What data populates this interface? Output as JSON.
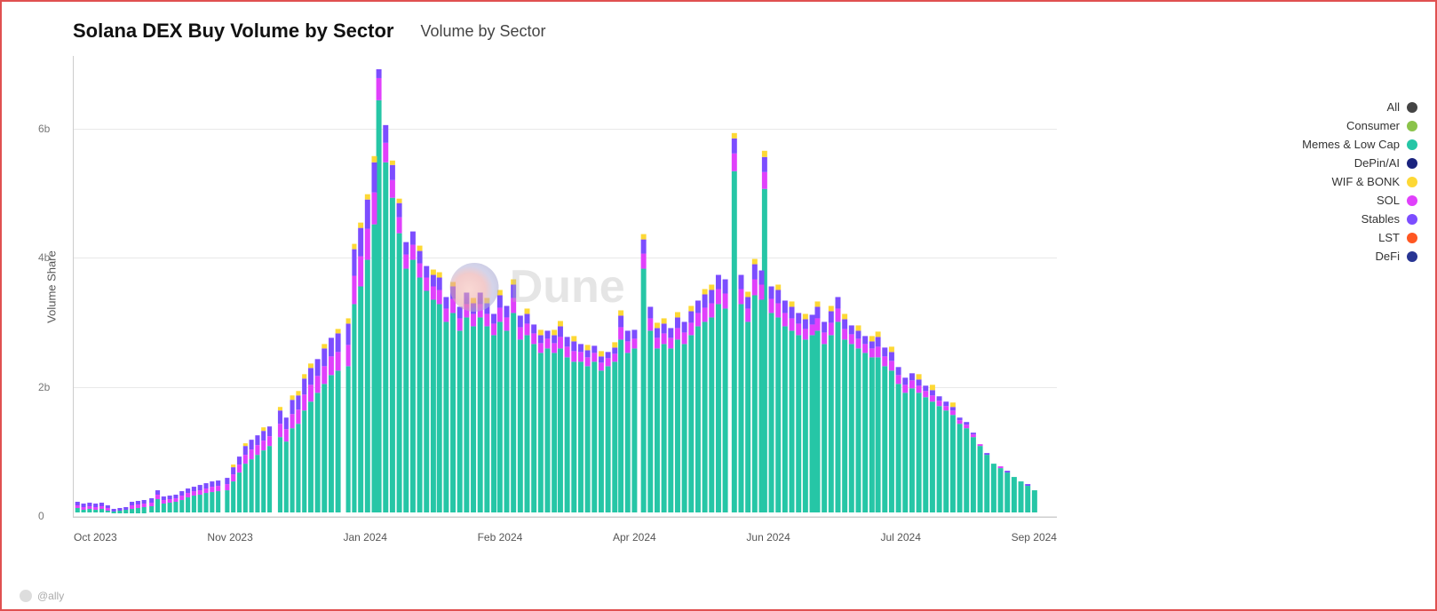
{
  "header": {
    "main_title": "Solana DEX Buy Volume by Sector",
    "sub_title": "Volume by Sector"
  },
  "chart": {
    "y_axis_label": "Volume Share",
    "y_ticks": [
      {
        "label": "0",
        "pct": 0
      },
      {
        "label": "2b",
        "pct": 28
      },
      {
        "label": "4b",
        "pct": 56
      },
      {
        "label": "6b",
        "pct": 84
      }
    ],
    "x_labels": [
      "Oct 2023",
      "Nov 2023",
      "Jan 2024",
      "Feb 2024",
      "Apr 2024",
      "Jun 2024",
      "Jul 2024",
      "Sep 2024"
    ]
  },
  "legend": {
    "items": [
      {
        "label": "All",
        "color": "#444444"
      },
      {
        "label": "Consumer",
        "color": "#8bc34a"
      },
      {
        "label": "Memes & Low Cap",
        "color": "#26c6a6"
      },
      {
        "label": "DePin/AI",
        "color": "#1a237e"
      },
      {
        "label": "WIF & BONK",
        "color": "#fdd835"
      },
      {
        "label": "SOL",
        "color": "#e040fb"
      },
      {
        "label": "Stables",
        "color": "#7c4dff"
      },
      {
        "label": "LST",
        "color": "#ff5722"
      },
      {
        "label": "DeFi",
        "color": "#283593"
      }
    ]
  },
  "watermark": {
    "text": "Dune"
  },
  "attribution": {
    "text": "@ally"
  }
}
